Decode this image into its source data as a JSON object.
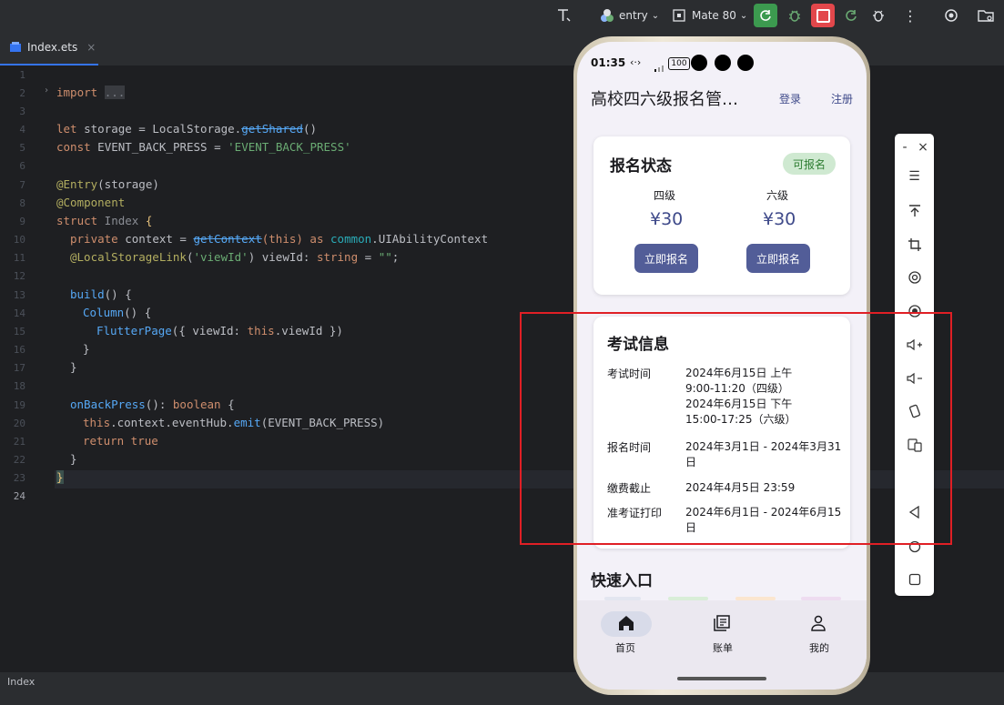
{
  "toolbar": {
    "module": "entry",
    "device": "Mate 80"
  },
  "tab": {
    "filename": "Index.ets",
    "close": "×"
  },
  "editor": {
    "line_numbers": [
      "1",
      "2",
      "3",
      "4",
      "5",
      "6",
      "7",
      "8",
      "9",
      "10",
      "11",
      "12",
      "13",
      "14",
      "15",
      "16",
      "17",
      "18",
      "19",
      "20",
      "21",
      "22",
      "23",
      "24"
    ],
    "import_kw": "import",
    "import_fold": "...",
    "l5_let": "let",
    "l5_rest": " storage = LocalStorage.",
    "l5_fn": "getShared",
    "l5_end": "()",
    "l6_const": "const",
    "l6_rest": " EVENT_BACK_PRESS = ",
    "l6_str": "'EVENT_BACK_PRESS'",
    "l8_ann": "@Entry",
    "l8_rest": "(storage)",
    "l9_ann": "@Component",
    "l10_kw": "struct",
    "l10_name": " Index ",
    "l10_brace": "{",
    "l11_kw": "private",
    "l11_rest": " context = ",
    "l11_fn": "getContext",
    "l11_this": "(this)",
    "l11_as": " as ",
    "l11_mod": "common",
    "l11_type": ".UIAbilityContext",
    "l12_ann": "@LocalStorageLink",
    "l12_str": "'viewId'",
    "l12_rest": ") viewId: ",
    "l12_type": "string",
    "l12_eq": " = ",
    "l12_val": "\"\"",
    "l12_end": ";",
    "l14_fn": "build",
    "l14_rest": "() {",
    "l15_fn": "Column",
    "l15_rest": "() {",
    "l16_fn": "FlutterPage",
    "l16_a": "({ viewId: ",
    "l16_this": "this",
    "l16_b": ".viewId })",
    "l17": "}",
    "l18": "}",
    "l20_fn": "onBackPress",
    "l20_rest": "(): ",
    "l20_kw": "boolean",
    "l20_end": " {",
    "l21_this": "this",
    "l21_a": ".context.eventHub.",
    "l21_fn": "emit",
    "l21_b": "(EVENT_BACK_PRESS)",
    "l22_kw": "return",
    "l22_val": " true",
    "l23": "}",
    "l24": "}"
  },
  "statusbar": {
    "breadcrumb": "Index"
  },
  "phone": {
    "status": {
      "time": "01:35",
      "battery": "100"
    },
    "appbar": {
      "title": "高校四六级报名管…",
      "login": "登录",
      "register": "注册"
    },
    "registration": {
      "title": "报名状态",
      "badge": "可报名",
      "cet4": {
        "name": "四级",
        "price": "¥30",
        "button": "立即报名"
      },
      "cet6": {
        "name": "六级",
        "price": "¥30",
        "button": "立即报名"
      }
    },
    "exam": {
      "title": "考试信息",
      "rows": [
        {
          "label": "考试时间",
          "value_lines": [
            "2024年6月15日 上午",
            "9:00-11:20（四级）",
            "2024年6月15日 下午",
            "15:00-17:25（六级）"
          ]
        },
        {
          "label": "报名时间",
          "value_lines": [
            "2024年3月1日 - 2024年3月31",
            "日"
          ]
        },
        {
          "label": "缴费截止",
          "value_lines": [
            "2024年4月5日 23:59"
          ]
        },
        {
          "label": "准考证打印",
          "value_lines": [
            "2024年6月1日 - 2024年6月15",
            "日"
          ]
        }
      ]
    },
    "quick": {
      "title": "快速入口"
    },
    "bottom_nav": [
      {
        "label": "首页",
        "icon": "home-icon",
        "active": true
      },
      {
        "label": "账单",
        "icon": "bill-icon",
        "active": false
      },
      {
        "label": "我的",
        "icon": "person-icon",
        "active": false
      }
    ]
  },
  "emulator_toolbar": {
    "minimize": "-",
    "close": "×"
  },
  "colors": {
    "accent_button": "#525d98",
    "badge_bg": "#cfe9d1",
    "badge_text": "#2e7d32",
    "highlight_box": "#e01f25",
    "run_green": "#3c9a4f",
    "stop_red": "#e2474b"
  }
}
